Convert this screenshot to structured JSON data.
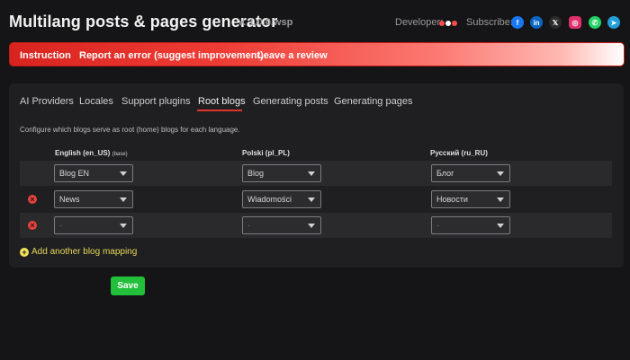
{
  "header": {
    "title": "Multilang posts & pages generator",
    "version": "v. 1.0.0.wsp",
    "developer_label": "Developer:",
    "developer_dots": [
      "#ff4d4d",
      "#ffffff",
      "#ff4d4d"
    ],
    "subscribe_label": "Subscribe:",
    "socials": [
      {
        "name": "facebook-icon",
        "glyph": "f",
        "color": "#1877f2"
      },
      {
        "name": "linkedin-icon",
        "glyph": "in",
        "color": "#0a66c2"
      },
      {
        "name": "x-icon",
        "glyph": "𝕏",
        "color": "#2b2b2b"
      },
      {
        "name": "instagram-icon",
        "glyph": "◎",
        "color": "#e1306c"
      },
      {
        "name": "whatsapp-icon",
        "glyph": "✆",
        "color": "#25d366"
      },
      {
        "name": "telegram-icon",
        "glyph": "➤",
        "color": "#229ed9"
      }
    ]
  },
  "banner": {
    "instruction": "Instruction",
    "report": "Report an error (suggest improvement)",
    "review": "Leave a review"
  },
  "tabs": [
    {
      "label": "AI Providers"
    },
    {
      "label": "Locales"
    },
    {
      "label": "Support plugins"
    },
    {
      "label": "Root blogs",
      "active": true
    },
    {
      "label": "Generating posts"
    },
    {
      "label": "Generating pages"
    }
  ],
  "description": "Configure which blogs serve as root (home) blogs for each language.",
  "columns": [
    {
      "label": "English (en_US)",
      "note": "(base)"
    },
    {
      "label": "Polski (pl_PL)",
      "note": ""
    },
    {
      "label": "Русский (ru_RU)",
      "note": ""
    }
  ],
  "rows": [
    {
      "removable": false,
      "values": [
        "Blog EN",
        "Blog",
        "Блог"
      ]
    },
    {
      "removable": true,
      "values": [
        "News",
        "Wiadomości",
        "Новости"
      ]
    },
    {
      "removable": true,
      "values": [
        "-",
        "-",
        "-"
      ]
    }
  ],
  "add_mapping_label": "Add another blog mapping",
  "save_label": "Save",
  "colors": {
    "accent_red": "#e0342b",
    "save_green": "#22c03a",
    "add_yellow": "#e8d85a"
  }
}
